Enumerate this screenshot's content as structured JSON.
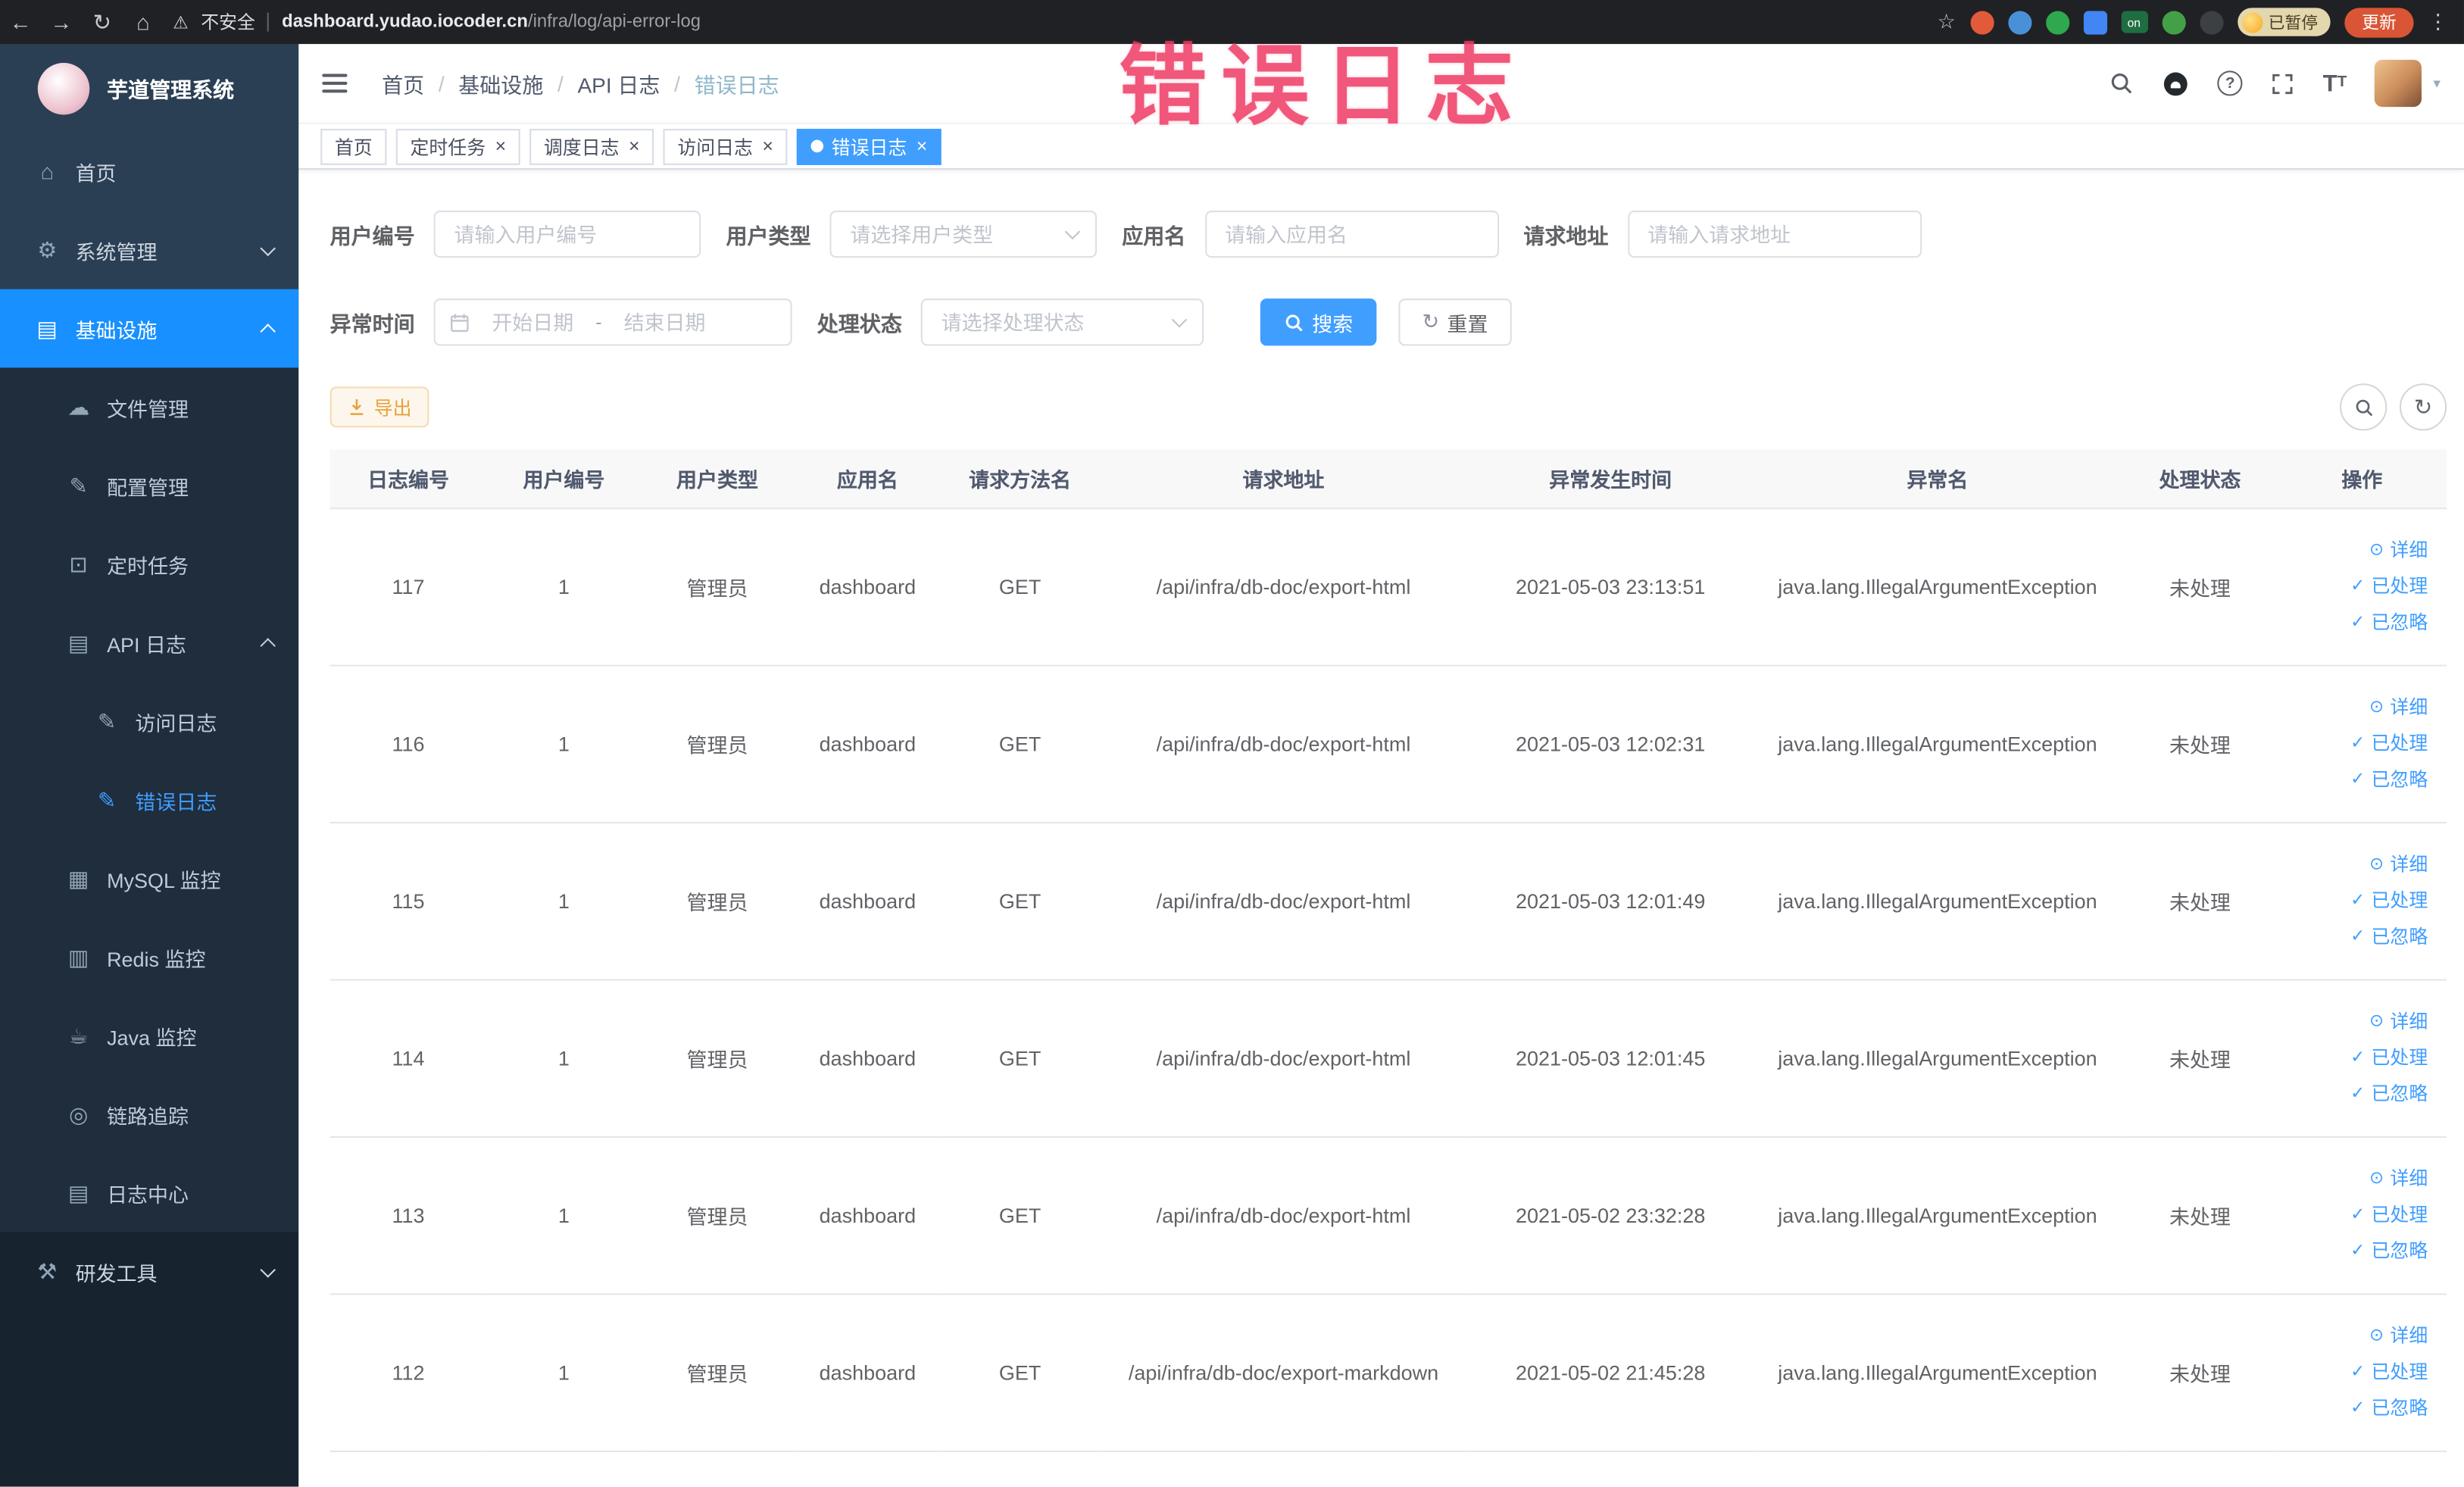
{
  "colors": {
    "accent_blue": "#409eff",
    "active_menu_blue": "#1890ff",
    "sidebar_bg": "#2a3f54",
    "sidebar_submenu_bg": "#1f2d3d",
    "browser_bar_bg": "#202124",
    "warning_button_text": "#e6a23c",
    "watermark_red": "#ee3a63"
  },
  "browser": {
    "security_label": "不安全",
    "url_domain": "dashboard.yudao.iocoder.cn",
    "url_path": "/infra/log/api-error-log",
    "extension_on_badge": "on",
    "paused_badge": "已暂停",
    "update_button": "更新"
  },
  "overlay": {
    "watermark": "错误日志"
  },
  "sidebar": {
    "logo_title": "芋道管理系统",
    "items": [
      {
        "label": "首页"
      },
      {
        "label": "系统管理"
      },
      {
        "label": "基础设施"
      },
      {
        "label": "文件管理"
      },
      {
        "label": "配置管理"
      },
      {
        "label": "定时任务"
      },
      {
        "label": "API 日志"
      },
      {
        "label": "访问日志"
      },
      {
        "label": "错误日志"
      },
      {
        "label": "MySQL 监控"
      },
      {
        "label": "Redis 监控"
      },
      {
        "label": "Java 监控"
      },
      {
        "label": "链路追踪"
      },
      {
        "label": "日志中心"
      },
      {
        "label": "研发工具"
      }
    ]
  },
  "breadcrumb": {
    "separator": "/",
    "items": [
      "首页",
      "基础设施",
      "API 日志",
      "错误日志"
    ]
  },
  "tabs": [
    {
      "label": "首页"
    },
    {
      "label": "定时任务"
    },
    {
      "label": "调度日志"
    },
    {
      "label": "访问日志"
    },
    {
      "label": "错误日志"
    }
  ],
  "filters": {
    "user_id_label": "用户编号",
    "user_id_placeholder": "请输入用户编号",
    "user_type_label": "用户类型",
    "user_type_placeholder": "请选择用户类型",
    "app_name_label": "应用名",
    "app_name_placeholder": "请输入应用名",
    "request_url_label": "请求地址",
    "request_url_placeholder": "请输入请求地址",
    "exception_time_label": "异常时间",
    "start_date_placeholder": "开始日期",
    "range_separator": "-",
    "end_date_placeholder": "结束日期",
    "process_status_label": "处理状态",
    "process_status_placeholder": "请选择处理状态",
    "search_button": "搜索",
    "reset_button": "重置"
  },
  "toolbar": {
    "export_button": "导出"
  },
  "table": {
    "headers": [
      "日志编号",
      "用户编号",
      "用户类型",
      "应用名",
      "请求方法名",
      "请求地址",
      "异常发生时间",
      "异常名",
      "处理状态",
      "操作"
    ],
    "action_labels": {
      "detail": "详细",
      "processed": "已处理",
      "ignored": "已忽略"
    },
    "rows": [
      {
        "log_id": "117",
        "user_id": "1",
        "user_type": "管理员",
        "app_name": "dashboard",
        "method": "GET",
        "request_url": "/api/infra/db-doc/export-html",
        "exception_time": "2021-05-03 23:13:51",
        "exception_name": "java.lang.IllegalArgumentException",
        "process_status": "未处理"
      },
      {
        "log_id": "116",
        "user_id": "1",
        "user_type": "管理员",
        "app_name": "dashboard",
        "method": "GET",
        "request_url": "/api/infra/db-doc/export-html",
        "exception_time": "2021-05-03 12:02:31",
        "exception_name": "java.lang.IllegalArgumentException",
        "process_status": "未处理"
      },
      {
        "log_id": "115",
        "user_id": "1",
        "user_type": "管理员",
        "app_name": "dashboard",
        "method": "GET",
        "request_url": "/api/infra/db-doc/export-html",
        "exception_time": "2021-05-03 12:01:49",
        "exception_name": "java.lang.IllegalArgumentException",
        "process_status": "未处理"
      },
      {
        "log_id": "114",
        "user_id": "1",
        "user_type": "管理员",
        "app_name": "dashboard",
        "method": "GET",
        "request_url": "/api/infra/db-doc/export-html",
        "exception_time": "2021-05-03 12:01:45",
        "exception_name": "java.lang.IllegalArgumentException",
        "process_status": "未处理"
      },
      {
        "log_id": "113",
        "user_id": "1",
        "user_type": "管理员",
        "app_name": "dashboard",
        "method": "GET",
        "request_url": "/api/infra/db-doc/export-html",
        "exception_time": "2021-05-02 23:32:28",
        "exception_name": "java.lang.IllegalArgumentException",
        "process_status": "未处理"
      },
      {
        "log_id": "112",
        "user_id": "1",
        "user_type": "管理员",
        "app_name": "dashboard",
        "method": "GET",
        "request_url": "/api/infra/db-doc/export-markdown",
        "exception_time": "2021-05-02 21:45:28",
        "exception_name": "java.lang.IllegalArgumentException",
        "process_status": "未处理"
      }
    ]
  }
}
